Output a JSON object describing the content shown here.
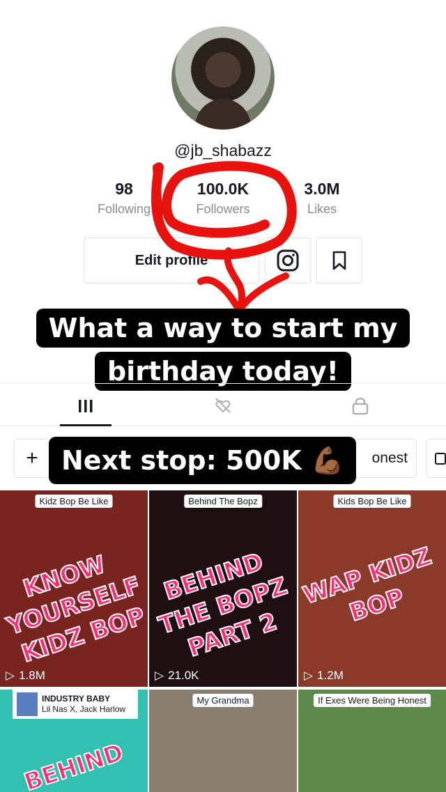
{
  "profile": {
    "username": "@jb_shabazz",
    "stats": [
      {
        "value": "98",
        "label": "Following"
      },
      {
        "value": "100.0K",
        "label": "Followers"
      },
      {
        "value": "3.0M",
        "label": "Likes"
      }
    ],
    "edit_label": "Edit profile",
    "instagram_icon": "instagram-icon",
    "bookmark_icon": "bookmark-icon"
  },
  "captions": {
    "line1": "What a way to start my",
    "line2": "birthday today!",
    "next_stop": "Next stop: 500K 💪🏾"
  },
  "tabs": [
    {
      "name": "videos-grid-icon"
    },
    {
      "name": "liked-hidden-icon"
    },
    {
      "name": "private-lock-icon"
    }
  ],
  "chips": {
    "plus": "+",
    "partial_label": "onest"
  },
  "videos": [
    {
      "badge": "Kidz Bop Be Like",
      "overlay": "KNOW YOURSELF KIDZ BOP",
      "views": "1.8M",
      "bg": "#7a2420"
    },
    {
      "badge": "Behind The Bopz",
      "overlay": "BEHIND THE BOPZ PART 2",
      "views": "21.0K",
      "bg": "#1f0f12"
    },
    {
      "badge": "Kids Bop Be Like",
      "overlay": "WAP KIDZ BOP",
      "views": "1.2M",
      "bg": "#8b3a2a"
    },
    {
      "badge": "",
      "overlay": "BEHIND",
      "views": "",
      "bg": "#32c0b0",
      "song_title": "INDUSTRY BABY",
      "song_artist": "Lil Nas X, Jack Harlow"
    },
    {
      "badge": "My Grandma",
      "overlay": "",
      "views": "",
      "bg": "#8a7e6e"
    },
    {
      "badge": "If Exes Were Being Honest",
      "overlay": "",
      "views": "",
      "bg": "#5d8a4a"
    }
  ],
  "colors": {
    "overlay_text": "#ff2a71",
    "annotation_red": "#e8130f"
  }
}
